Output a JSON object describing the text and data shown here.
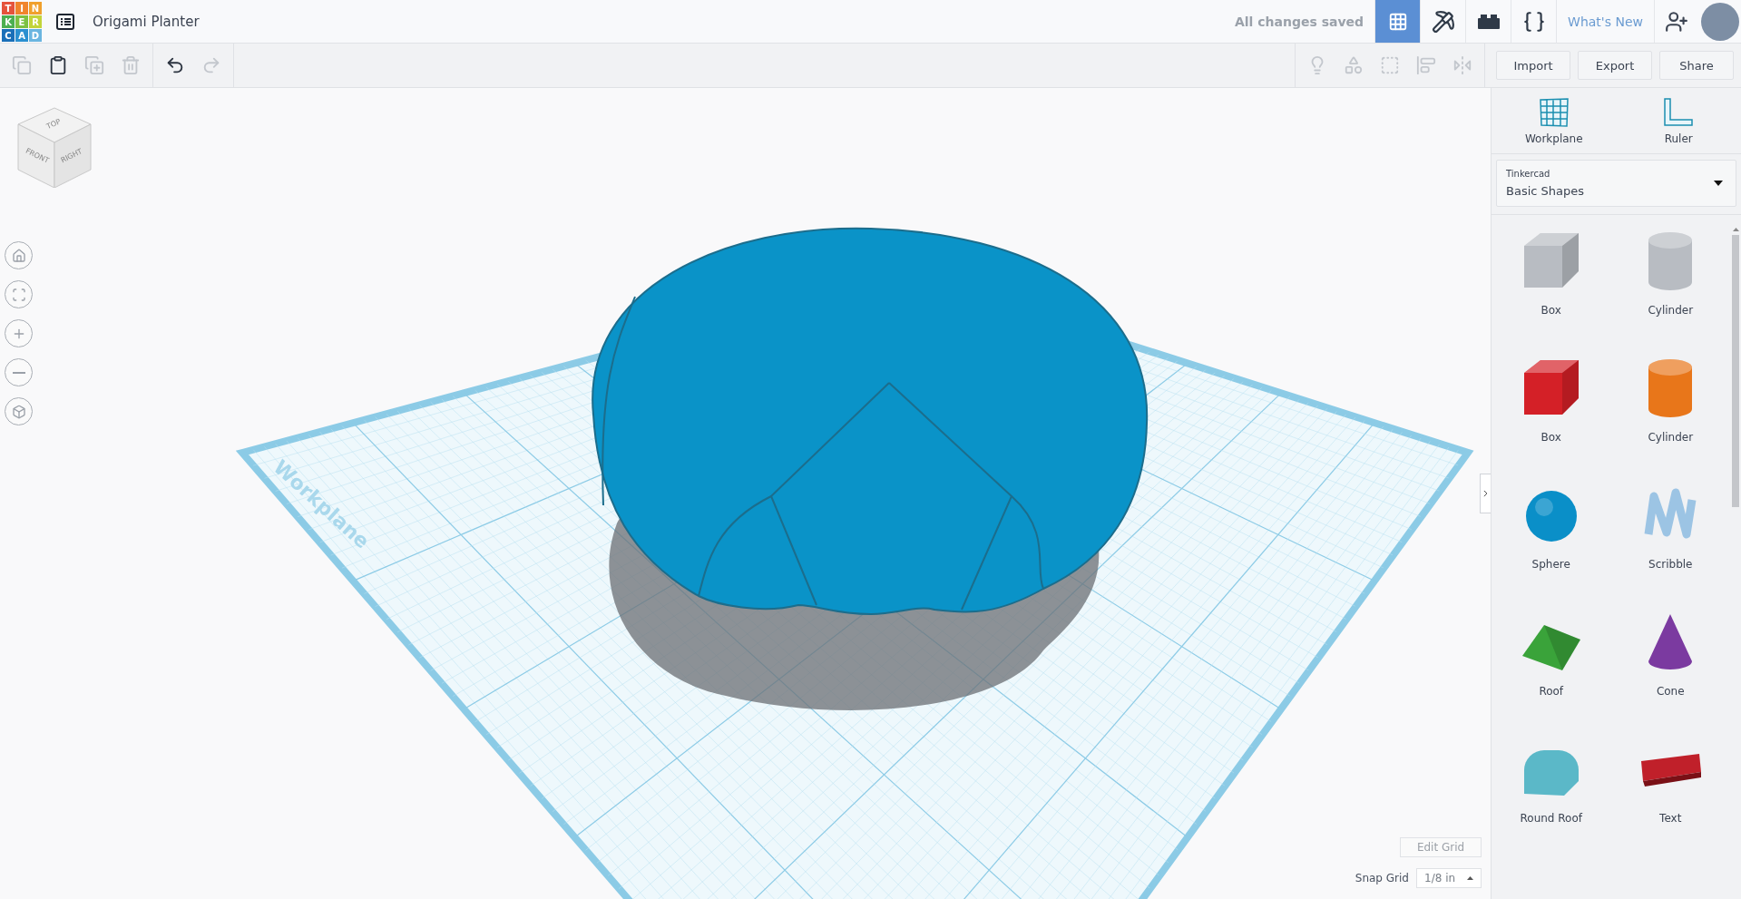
{
  "header": {
    "logo": [
      {
        "letter": "T",
        "color": "#e5533c"
      },
      {
        "letter": "I",
        "color": "#f0842c"
      },
      {
        "letter": "N",
        "color": "#f0a02c"
      },
      {
        "letter": "K",
        "color": "#4caf50"
      },
      {
        "letter": "E",
        "color": "#7cc142"
      },
      {
        "letter": "R",
        "color": "#c2d43a"
      },
      {
        "letter": "C",
        "color": "#1a6fb8"
      },
      {
        "letter": "A",
        "color": "#2a8fd0"
      },
      {
        "letter": "D",
        "color": "#6ab5e0"
      }
    ],
    "title": "Origami Planter",
    "save_status": "All changes saved",
    "views": [
      {
        "kind": "grid",
        "selected": true
      },
      {
        "kind": "pickaxe",
        "selected": false
      },
      {
        "kind": "brick",
        "selected": false
      },
      {
        "kind": "code",
        "selected": false
      }
    ],
    "whats_new": "What's New"
  },
  "toolbar": {
    "edit_tools": [
      {
        "kind": "copy",
        "disabled": true
      },
      {
        "kind": "paste",
        "disabled": false
      },
      {
        "kind": "duplicate",
        "disabled": true
      },
      {
        "kind": "delete",
        "disabled": true
      }
    ],
    "history_tools": [
      {
        "kind": "undo",
        "disabled": false
      },
      {
        "kind": "redo",
        "disabled": true
      }
    ],
    "shape_tools": [
      {
        "kind": "note",
        "disabled": true
      },
      {
        "kind": "group",
        "disabled": true
      },
      {
        "kind": "ungroup",
        "disabled": true
      },
      {
        "kind": "align",
        "disabled": true
      },
      {
        "kind": "mirror",
        "disabled": true
      }
    ],
    "buttons": [
      "Import",
      "Export",
      "Share"
    ]
  },
  "view_cube": {
    "top": "TOP",
    "front": "FRONT",
    "right": "RIGHT"
  },
  "nav_controls": [
    {
      "kind": "home"
    },
    {
      "kind": "fit"
    },
    {
      "kind": "zoom_in"
    },
    {
      "kind": "zoom_out"
    },
    {
      "kind": "ortho"
    }
  ],
  "workplane_label": "Workplane",
  "grid_controls": {
    "edit_grid": "Edit Grid",
    "snap_label": "Snap Grid",
    "snap_value": "1/8 in"
  },
  "panel": {
    "tools": [
      {
        "kind": "workplane",
        "label": "Workplane"
      },
      {
        "kind": "ruler",
        "label": "Ruler"
      }
    ],
    "library": {
      "source": "Tinkercad",
      "category": "Basic Shapes"
    },
    "shapes": [
      {
        "kind": "box",
        "label": "Box",
        "color": "#b8bcc2"
      },
      {
        "kind": "cylinder",
        "label": "Cylinder",
        "color": "#b8bcc2"
      },
      {
        "kind": "box",
        "label": "Box",
        "color": "#d42027"
      },
      {
        "kind": "cylinder",
        "label": "Cylinder",
        "color": "#e8761a"
      },
      {
        "kind": "sphere",
        "label": "Sphere",
        "color": "#0a8fc8"
      },
      {
        "kind": "scribble",
        "label": "Scribble",
        "color": "#9cc4e4"
      },
      {
        "kind": "roof",
        "label": "Roof",
        "color": "#3aa33a"
      },
      {
        "kind": "cone",
        "label": "Cone",
        "color": "#7b3aa0"
      },
      {
        "kind": "round_roof",
        "label": "Round Roof",
        "color": "#5bb8c8"
      },
      {
        "kind": "text",
        "label": "Text",
        "color": "#c0202a"
      }
    ]
  }
}
